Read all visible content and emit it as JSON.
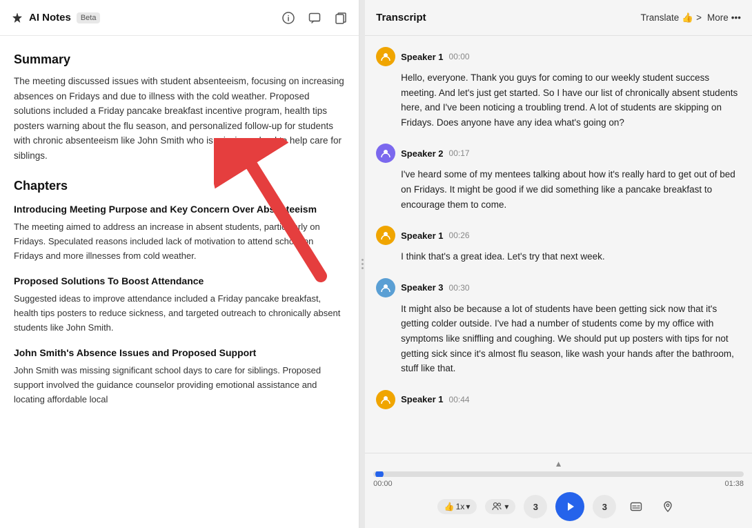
{
  "left": {
    "header": {
      "title": "AI Notes",
      "beta_label": "Beta"
    },
    "summary": {
      "title": "Summary",
      "text": "The meeting discussed issues with student absenteeism, focusing on increasing absences on Fridays and due to illness with the cold weather. Proposed solutions included a Friday pancake breakfast incentive program, health tips posters warning about the flu season, and personalized follow-up for students with chronic absenteeism like John Smith who is missing school to help care for siblings."
    },
    "chapters_title": "Chapters",
    "chapters": [
      {
        "heading": "Introducing Meeting Purpose and Key Concern Over Absenteeism",
        "text": "The meeting aimed to address an increase in absent students, particularly on Fridays. Speculated reasons included lack of motivation to attend school on Fridays and more illnesses from cold weather."
      },
      {
        "heading": "Proposed Solutions To Boost Attendance",
        "text": "Suggested ideas to improve attendance included a Friday pancake breakfast, health tips posters to reduce sickness, and targeted outreach to chronically absent students like John Smith."
      },
      {
        "heading": "John Smith's Absence Issues and Proposed Support",
        "text": "John Smith was missing significant school days to care for siblings. Proposed support involved the guidance counselor providing emotional assistance and locating affordable local"
      }
    ]
  },
  "right": {
    "header": {
      "title": "Transcript",
      "translate_label": "Translate",
      "translate_icon": "👍",
      "chevron": ">",
      "more_label": "More",
      "more_icon": "⋯"
    },
    "speakers": [
      {
        "name": "Speaker 1",
        "time": "00:00",
        "avatar_type": "1",
        "text": "Hello, everyone. Thank you guys for coming to our weekly student success meeting. And let's just get started. So I have our list of chronically absent students here, and I've been noticing a troubling trend. A lot of students are skipping on Fridays. Does anyone have any idea what's going on?"
      },
      {
        "name": "Speaker 2",
        "time": "00:17",
        "avatar_type": "2",
        "text": "I've heard some of my mentees talking about how it's really hard to get out of bed on Fridays. It might be good if we did something like a pancake breakfast to encourage them to come."
      },
      {
        "name": "Speaker 1",
        "time": "00:26",
        "avatar_type": "1",
        "text": "I think that's a great idea. Let's try that next week."
      },
      {
        "name": "Speaker 3",
        "time": "00:30",
        "avatar_type": "3",
        "text": "It might also be because a lot of students have been getting sick now that it's getting colder outside. I've had a number of students come by my office with symptoms like sniffling and coughing. We should put up posters with tips for not getting sick since it's almost flu season, like wash your hands after the bathroom, stuff like that."
      },
      {
        "name": "Speaker 1",
        "time": "00:44",
        "avatar_type": "1",
        "text": ""
      }
    ],
    "player": {
      "current_time": "00:00",
      "total_time": "01:38",
      "speed_label": "1x",
      "skip_back": "3",
      "skip_forward": "3"
    }
  }
}
